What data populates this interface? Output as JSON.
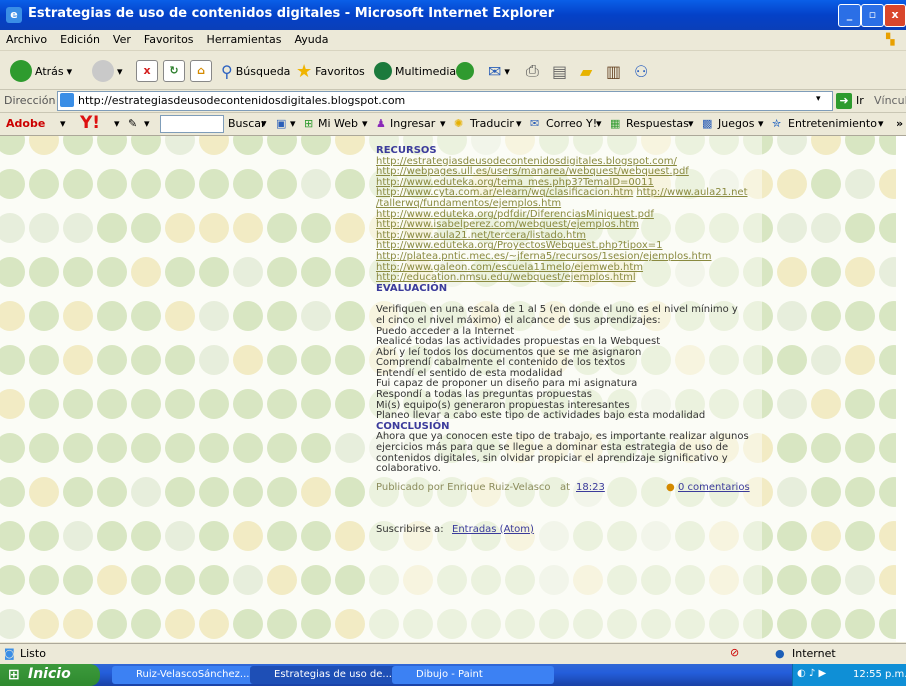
{
  "window": {
    "title": "Estrategias de uso de contenidos digitales - Microsoft Internet Explorer"
  },
  "menu": [
    "Archivo",
    "Edición",
    "Ver",
    "Favoritos",
    "Herramientas",
    "Ayuda"
  ],
  "toolbar": {
    "back": "Atrás",
    "search": "Búsqueda",
    "favorites": "Favoritos",
    "multimedia": "Multimedia"
  },
  "address": {
    "label": "Dirección",
    "url": "http://estrategiasdeusodecontenidosdigitales.blogspot.com",
    "go": "Ir",
    "links": "Vínculos"
  },
  "yahoo": {
    "adobe": "Adobe",
    "search_button": "Buscar",
    "mi_web": "Mi Web",
    "ingresar": "Ingresar",
    "traducir": "Traducir",
    "correo": "Correo Y!",
    "respuestas": "Respuestas",
    "juegos": "Juegos",
    "entretenimiento": "Entretenimiento"
  },
  "post": {
    "recursos_heading": "RECURSOS",
    "links": [
      "http://estrategiasdeusodecontenidosdigitales.blogspot.com/",
      "http://webpages.ull.es/users/manarea/webquest/webquest.pdf",
      "http://www.eduteka.org/tema_mes.php3?TemaID=0011",
      "http://www.cyta.com.ar/elearn/wq/clasificacion.htm",
      "http://www.aula21.net",
      "/tallerwq/fundamentos/ejemplos.htm",
      "http://www.eduteka.org/pdfdir/DiferenciasMiniquest.pdf",
      "http://www.isabelperez.com/webquest/ejemplos.htm",
      "http://www.aula21.net/tercera/listado.htm",
      "http://www.eduteka.org/ProyectosWebquest.php?tipox=1",
      "http://platea.pntic.mec.es/~jferna5/recursos/1sesion/ejemplos.htm",
      "http://www.galeon.com/escuela11melo/ejemweb.htm",
      "http://education.nmsu.edu/webquest/ejemplos.html"
    ],
    "evaluacion_heading": "EVALUACIÓN",
    "evaluacion_intro_1": "Verifiquen en una escala de 1 al 5 (en donde el uno es el nivel mínimo y",
    "evaluacion_intro_2": "el cinco el nivel máximo) el alcance de sus aprendizajes:",
    "evaluacion_items": [
      "Puedo acceder a la Internet",
      "Realicé todas las actividades propuestas en la Webquest",
      "Abrí y leí todos los documentos que se me asignaron",
      "Comprendí cabalmente el contenido de los textos",
      "Entendí el sentido de esta modalidad",
      "Fui capaz de proponer un diseño para mi asignatura",
      "Respondí a todas las preguntas propuestas",
      "Mi(s) equipo(s) generaron propuestas interesantes",
      "Planeo llevar a cabo este tipo de actividades bajo esta modalidad"
    ],
    "conclusion_heading": "CONCLUSIÓN",
    "conclusion_lines": [
      "Ahora que ya conocen este tipo de trabajo, es importante realizar algunos",
      "ejercicios más para que se llegue a dominar esta estrategia de uso de",
      "contenidos digitales, sin olvidar propiciar el aprendizaje significativo y",
      "colaborativo."
    ],
    "published_by": "Publicado por Enrique Ruiz-Velasco",
    "at": "at",
    "time": "18:23",
    "comments": "0 comentarios",
    "subscribe_label": "Suscribirse a:",
    "subscribe_link": "Entradas (Atom)"
  },
  "status": {
    "text": "Listo",
    "zone": "Internet"
  },
  "taskbar": {
    "start": "Inicio",
    "tasks": [
      "Ruiz-VelascoSánchez...",
      "Estrategias de uso de...",
      "Dibujo - Paint"
    ],
    "clock": "12:55 p.m."
  },
  "colors": {
    "dot_green": "#D8E6C2",
    "dot_yellow": "#F2EBC4",
    "heading": "#3B3B9B",
    "link": "#8A8A40"
  }
}
